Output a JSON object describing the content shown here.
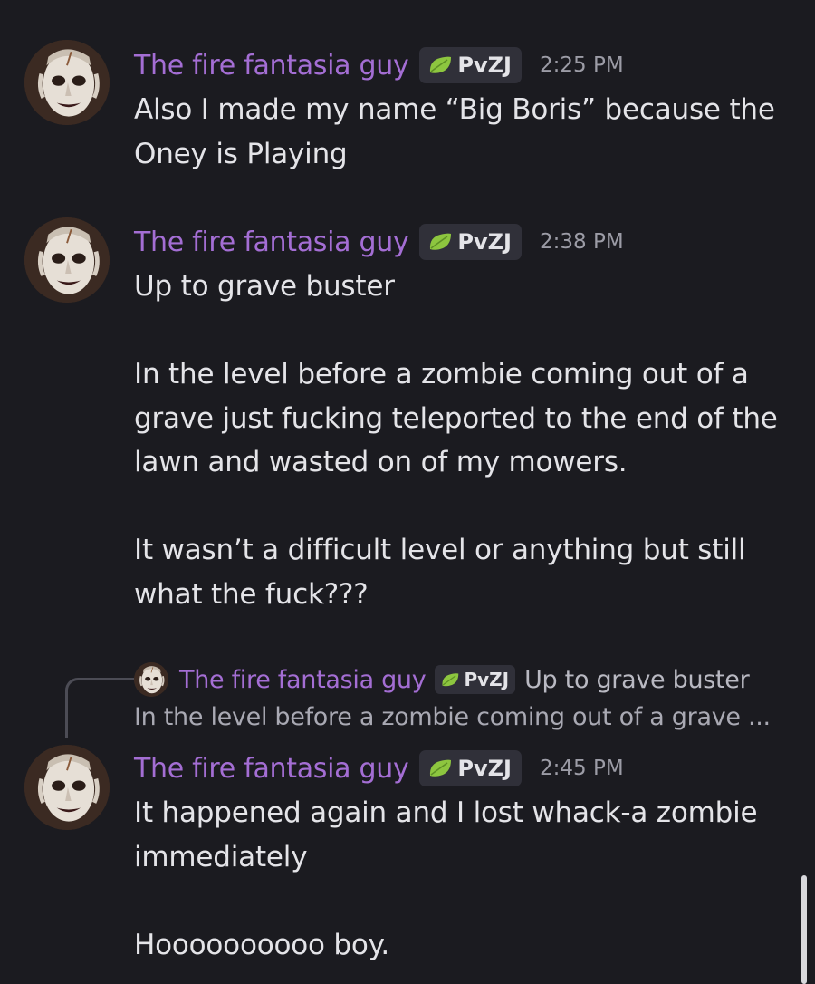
{
  "messages": [
    {
      "username": "The fire fantasia guy",
      "tag": "PvZJ",
      "time": "2:25 PM",
      "text": "Also I made my name “Big Boris” because the\nOney is Playing"
    },
    {
      "username": "The fire fantasia guy",
      "tag": "PvZJ",
      "time": "2:38 PM",
      "text": "Up to grave buster\n\nIn the level before a zombie coming out of a\ngrave just fucking teleported to the end of the\nlawn and wasted on of my mowers.\n\nIt wasn’t a difficult level or anything but still\nwhat the fuck???"
    },
    {
      "username": "The fire fantasia guy",
      "tag": "PvZJ",
      "time": "2:45 PM",
      "text": "It happened again and I lost whack-a zombie\nimmediately\n\nHoooooooooo boy."
    }
  ],
  "reply": {
    "username": "The fire fantasia guy",
    "tag": "PvZJ",
    "snippet": "Up to grave buster",
    "second_line": "In the level before a zombie coming out of a grave ..."
  },
  "colors": {
    "background": "#1b1b20",
    "username": "#a46ed4",
    "tag_bg": "#303039",
    "leaf": "#8dc63f"
  },
  "icons": {
    "tag_icon": "leaf-icon",
    "avatar": "face-avatar"
  }
}
